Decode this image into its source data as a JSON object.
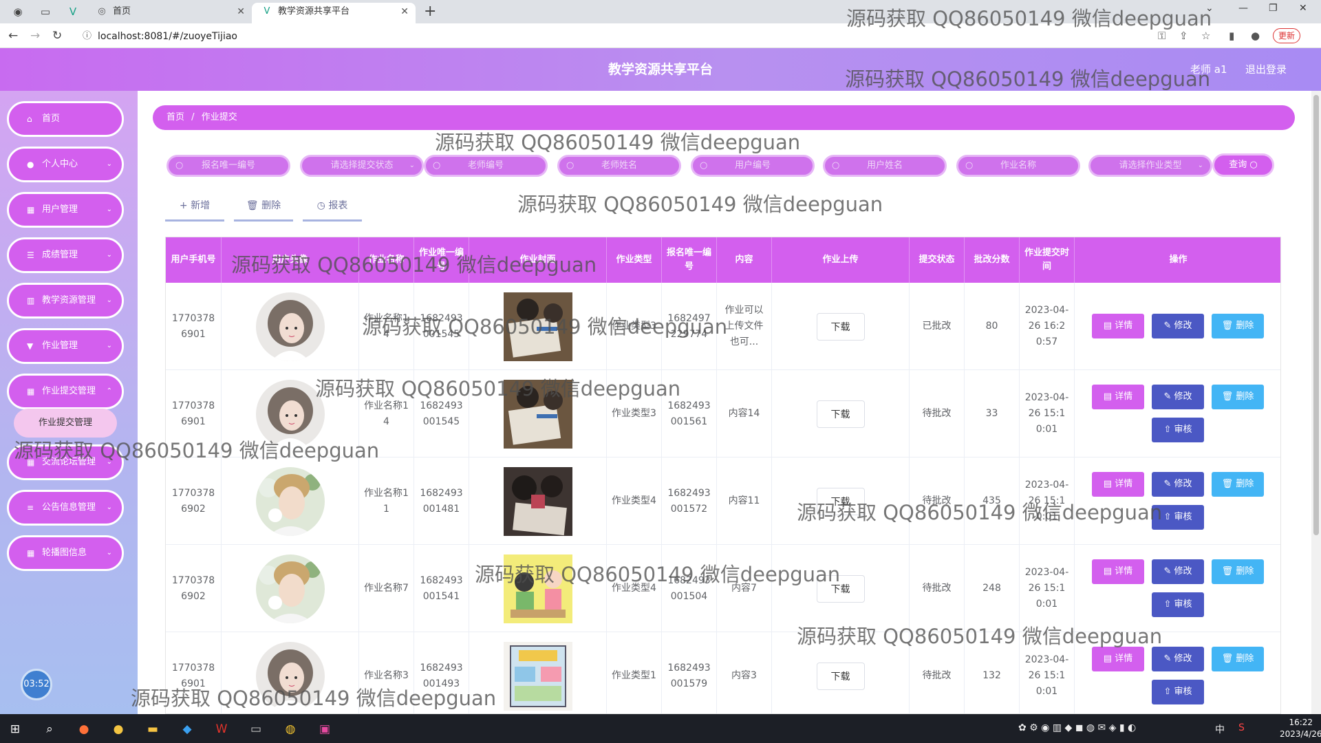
{
  "browser": {
    "tab1_title": "首页",
    "tab2_title": "教学资源共享平台",
    "url": "localhost:8081/#/zuoyeTijiao",
    "update_label": "更新"
  },
  "header": {
    "title": "教学资源共享平台",
    "user": "老师 a1",
    "logout": "退出登录"
  },
  "sidebar": {
    "items": [
      {
        "label": "首页",
        "icon": "home-icon"
      },
      {
        "label": "个人中心",
        "icon": "user-icon"
      },
      {
        "label": "用户管理",
        "icon": "grid-icon"
      },
      {
        "label": "成绩管理",
        "icon": "sliders-icon"
      },
      {
        "label": "教学资源管理",
        "icon": "chart-icon"
      },
      {
        "label": "作业管理",
        "icon": "trophy-icon"
      },
      {
        "label": "作业提交管理",
        "icon": "grid-icon"
      },
      {
        "label": "交流论坛管理",
        "icon": "grid-icon"
      },
      {
        "label": "公告信息管理",
        "icon": "list-icon"
      },
      {
        "label": "轮播图信息",
        "icon": "grid-icon"
      }
    ],
    "submenu_label": "作业提交管理"
  },
  "breadcrumb": {
    "home": "首页",
    "sep": "/",
    "current": "作业提交"
  },
  "filters": [
    {
      "placeholder": "报名唯一编号",
      "type": "input"
    },
    {
      "placeholder": "请选择提交状态",
      "type": "select"
    },
    {
      "placeholder": "老师编号",
      "type": "input"
    },
    {
      "placeholder": "老师姓名",
      "type": "input"
    },
    {
      "placeholder": "用户编号",
      "type": "input"
    },
    {
      "placeholder": "用户姓名",
      "type": "input"
    },
    {
      "placeholder": "作业名称",
      "type": "input"
    },
    {
      "placeholder": "请选择作业类型",
      "type": "select"
    }
  ],
  "query_label": "查询",
  "actions": {
    "add": "+ 新增",
    "delete": "删除",
    "report": "报表"
  },
  "table": {
    "headers": [
      "用户手机号",
      "用户头像",
      "作业名称",
      "作业唯一编号",
      "作业封面",
      "作业类型",
      "报名唯一编号",
      "内容",
      "作业上传",
      "提交状态",
      "批改分数",
      "作业提交时间",
      "操作"
    ],
    "download_label": "下载",
    "op_labels": {
      "detail": "详情",
      "edit": "修改",
      "delete": "删除",
      "audit": "审核"
    },
    "rows": [
      {
        "phone": "17703786901",
        "name": "作业名称14",
        "zuoye_no": "1682493001545",
        "type": "作业类型3",
        "baoming_no": "1682497229774",
        "content": "作业可以上传文件也可...",
        "status": "已批改",
        "score": "80",
        "time": "2023-04-26 16:20:57",
        "audit": false
      },
      {
        "phone": "17703786901",
        "name": "作业名称14",
        "zuoye_no": "1682493001545",
        "type": "作业类型3",
        "baoming_no": "1682493001561",
        "content": "内容14",
        "status": "待批改",
        "score": "33",
        "time": "2023-04-26 15:10:01",
        "audit": true
      },
      {
        "phone": "17703786902",
        "name": "作业名称11",
        "zuoye_no": "1682493001481",
        "type": "作业类型4",
        "baoming_no": "1682493001572",
        "content": "内容11",
        "status": "待批改",
        "score": "435",
        "time": "2023-04-26 15:10:01",
        "audit": true
      },
      {
        "phone": "17703786902",
        "name": "作业名称7",
        "zuoye_no": "1682493001541",
        "type": "作业类型4",
        "baoming_no": "1682493001504",
        "content": "内容7",
        "status": "待批改",
        "score": "248",
        "time": "2023-04-26 15:10:01",
        "audit": true
      },
      {
        "phone": "17703786901",
        "name": "作业名称3",
        "zuoye_no": "1682493001493",
        "type": "作业类型1",
        "baoming_no": "1682493001579",
        "content": "内容3",
        "status": "待批改",
        "score": "132",
        "time": "2023-04-26 15:10:01",
        "audit": true
      }
    ]
  },
  "watermark": "源码获取 QQ86050149 微信deepguan",
  "clock": "03:52",
  "taskbar": {
    "time": "16:22",
    "date": "2023/4/26",
    "ime": "中"
  },
  "colors": {
    "primary": "#d35fee",
    "edit": "#4b58c4",
    "delete": "#43b5f5"
  }
}
